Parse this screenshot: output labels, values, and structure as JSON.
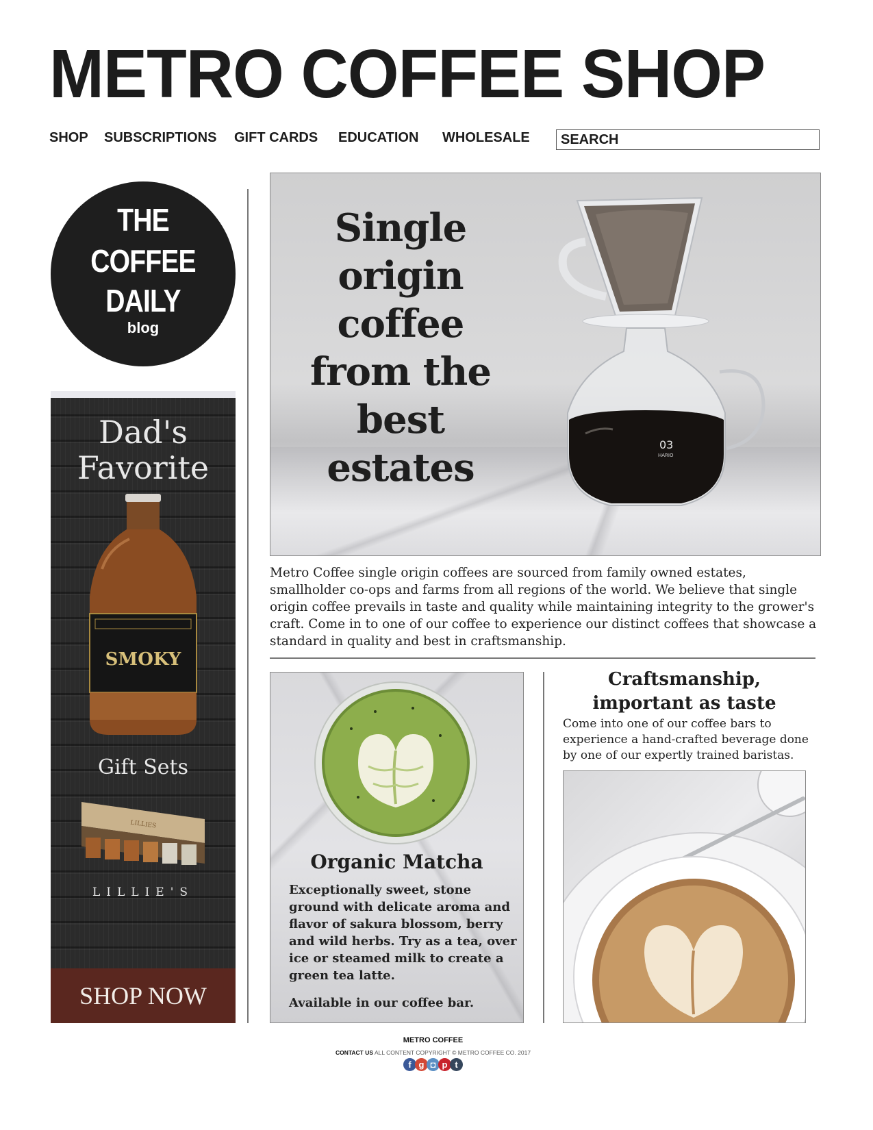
{
  "header": {
    "title": "METRO COFFEE SHOP",
    "nav": [
      "SHOP",
      "SUBSCRIPTIONS",
      "GIFT CARDS",
      "EDUCATION",
      "WHOLESALE"
    ],
    "search_placeholder": "SEARCH"
  },
  "blog_badge": {
    "line1": "THE",
    "line2": "COFFEE",
    "line3": "DAILY",
    "sub": "blog"
  },
  "ad": {
    "headline_1": "Dad's",
    "headline_2": "Favorite",
    "bottle_label": "SMOKY",
    "gift_sets": "Gift Sets",
    "box_label": "LILLIES",
    "brand": "LILLIE'S",
    "cta": "SHOP NOW"
  },
  "hero": {
    "headline": "Single\norigin\ncoffee\nfrom the\nbest\nestates",
    "carafe_marking": "03",
    "carafe_brand": "HARIO",
    "body": "Metro Coffee single origin coffees are sourced from family owned estates, smallholder co-ops and farms from all regions of the world. We believe that single origin coffee prevails in taste and quality while maintaining integrity to the grower's craft. Come in to one of our coffee to experience our distinct coffees that showcase a standard in quality and best in craftsmanship."
  },
  "matcha": {
    "title": "Organic Matcha",
    "description": "Exceptionally sweet, stone ground with delicate aroma and flavor of sakura blossom, berry and wild herbs. Try as a tea, over ice or steamed milk to create a green tea latte.",
    "availability": "Available in our coffee bar."
  },
  "craftsmanship": {
    "title": "Craftsmanship,\nimportant as taste",
    "body": "Come into one of our coffee bars to experience a hand-crafted beverage done by one of our expertly trained baristas."
  },
  "footer": {
    "brand": "METRO COFFEE",
    "contact_label": "CONTACT US",
    "copyright": "ALL CONTENT COPYRIGHT © METRO COFFEE CO. 2017",
    "social": [
      {
        "icon": "facebook-icon",
        "glyph": "f",
        "color": "#3b5998"
      },
      {
        "icon": "google-plus-icon",
        "glyph": "g",
        "color": "#d34836"
      },
      {
        "icon": "instagram-icon",
        "glyph": "◘",
        "color": "#5b8fc4"
      },
      {
        "icon": "pinterest-icon",
        "glyph": "p",
        "color": "#c8232c"
      },
      {
        "icon": "tumblr-icon",
        "glyph": "t",
        "color": "#35465c"
      }
    ]
  }
}
